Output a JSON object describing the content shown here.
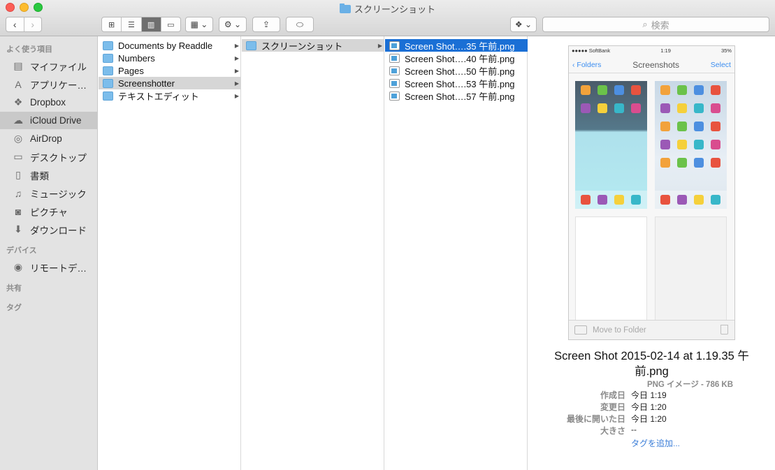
{
  "window": {
    "title": "スクリーンショット"
  },
  "toolbar": {
    "back": "‹",
    "forward": "›",
    "views": [
      "⊞",
      "☰",
      "▥",
      "▭"
    ],
    "arrange": "▦ ⌄",
    "action": "⚙ ⌄",
    "share": "⇪",
    "tag": "⬭",
    "dropbox": "❖ ⌄",
    "search_placeholder": "検索"
  },
  "sidebar": {
    "sections": [
      {
        "header": "よく使う項目",
        "items": [
          {
            "label": "マイファイル",
            "icon": "all-files-icon",
            "glyph": "▤"
          },
          {
            "label": "アプリケー…",
            "icon": "applications-icon",
            "glyph": "A"
          },
          {
            "label": "Dropbox",
            "icon": "dropbox-icon",
            "glyph": "❖"
          },
          {
            "label": "iCloud Drive",
            "icon": "icloud-icon",
            "glyph": "☁"
          },
          {
            "label": "AirDrop",
            "icon": "airdrop-icon",
            "glyph": "◎"
          },
          {
            "label": "デスクトップ",
            "icon": "desktop-icon",
            "glyph": "▭"
          },
          {
            "label": "書類",
            "icon": "documents-icon",
            "glyph": "▯"
          },
          {
            "label": "ミュージック",
            "icon": "music-icon",
            "glyph": "♫"
          },
          {
            "label": "ピクチャ",
            "icon": "pictures-icon",
            "glyph": "◙"
          },
          {
            "label": "ダウンロード",
            "icon": "downloads-icon",
            "glyph": "⬇"
          }
        ]
      },
      {
        "header": "デバイス",
        "items": [
          {
            "label": "リモートデ…",
            "icon": "remote-disc-icon",
            "glyph": "◉"
          }
        ]
      },
      {
        "header": "共有",
        "items": []
      },
      {
        "header": "タグ",
        "items": []
      }
    ],
    "selected": "iCloud Drive"
  },
  "columns": {
    "col1": [
      {
        "label": "Documents by Readdle",
        "arrow": "▶"
      },
      {
        "label": "Numbers",
        "arrow": "▶"
      },
      {
        "label": "Pages",
        "arrow": "▶"
      },
      {
        "label": "Screenshotter",
        "arrow": "▶"
      },
      {
        "label": "テキストエディット",
        "arrow": "▶"
      }
    ],
    "col2": [
      {
        "label": "スクリーンショット",
        "arrow": "▶"
      }
    ],
    "col3": [
      {
        "label": "Screen Shot….35 午前.png"
      },
      {
        "label": "Screen Shot….40 午前.png"
      },
      {
        "label": "Screen Shot….50 午前.png"
      },
      {
        "label": "Screen Shot….53 午前.png"
      },
      {
        "label": "Screen Shot….57 午前.png"
      }
    ]
  },
  "preview": {
    "phone": {
      "carrier": "●●●●● SoftBank",
      "time": "1:19",
      "battery": "35%",
      "back_label": "Folders",
      "title": "Screenshots",
      "select": "Select",
      "move_to_folder": "Move to Folder"
    },
    "filename": "Screen Shot 2015-02-14 at 1.19.35 午前.png",
    "filetype": "PNG イメージ - 786 KB",
    "meta": [
      {
        "key": "作成日",
        "value": "今日 1:19"
      },
      {
        "key": "変更日",
        "value": "今日 1:20"
      },
      {
        "key": "最後に開いた日",
        "value": "今日 1:20"
      },
      {
        "key": "大きさ",
        "value": "--"
      }
    ],
    "add_tag": "タグを追加..."
  }
}
